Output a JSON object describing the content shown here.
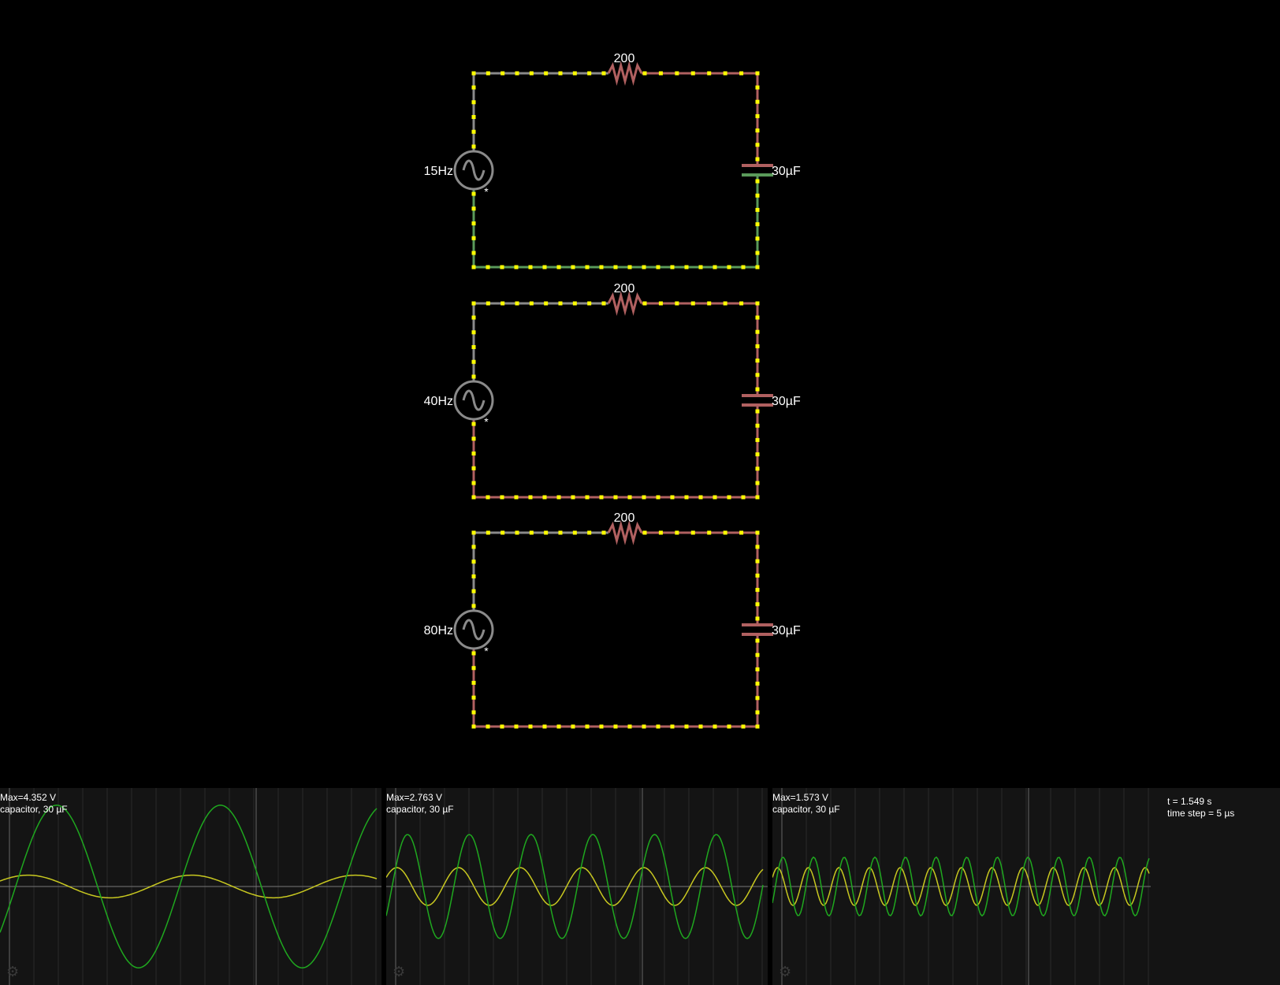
{
  "circuits": [
    {
      "source_freq": "15Hz",
      "resistor": "200",
      "capacitor": "30µF",
      "polarity_mark": "*"
    },
    {
      "source_freq": "40Hz",
      "resistor": "200",
      "capacitor": "30µF",
      "polarity_mark": "*"
    },
    {
      "source_freq": "80Hz",
      "resistor": "200",
      "capacitor": "30µF",
      "polarity_mark": "*"
    }
  ],
  "scopes": [
    {
      "max": "Max=4.352 V",
      "label": "capacitor, 30 µF",
      "cycles": 2.3,
      "green_amp": 0.86,
      "yellow_amp": 0.12
    },
    {
      "max": "Max=2.763 V",
      "label": "capacitor, 30 µF",
      "cycles": 6.1,
      "green_amp": 0.55,
      "yellow_amp": 0.2
    },
    {
      "max": "Max=1.573 V",
      "label": "capacitor, 30 µF",
      "cycles": 12.3,
      "green_amp": 0.31,
      "yellow_amp": 0.2
    }
  ],
  "status": {
    "time": "t = 1.549 s",
    "time_step": "time step = 5 µs"
  },
  "colors": {
    "background": "#000000",
    "wire_neutral": "#8a8a8a",
    "wire_negative": "#b06060",
    "wire_positive": "#5a9a5a",
    "current_dot": "#ffff00",
    "trace_voltage": "#1fa81f",
    "trace_current": "#c8c820",
    "scope_bg": "#141414",
    "grid": "#404040"
  }
}
